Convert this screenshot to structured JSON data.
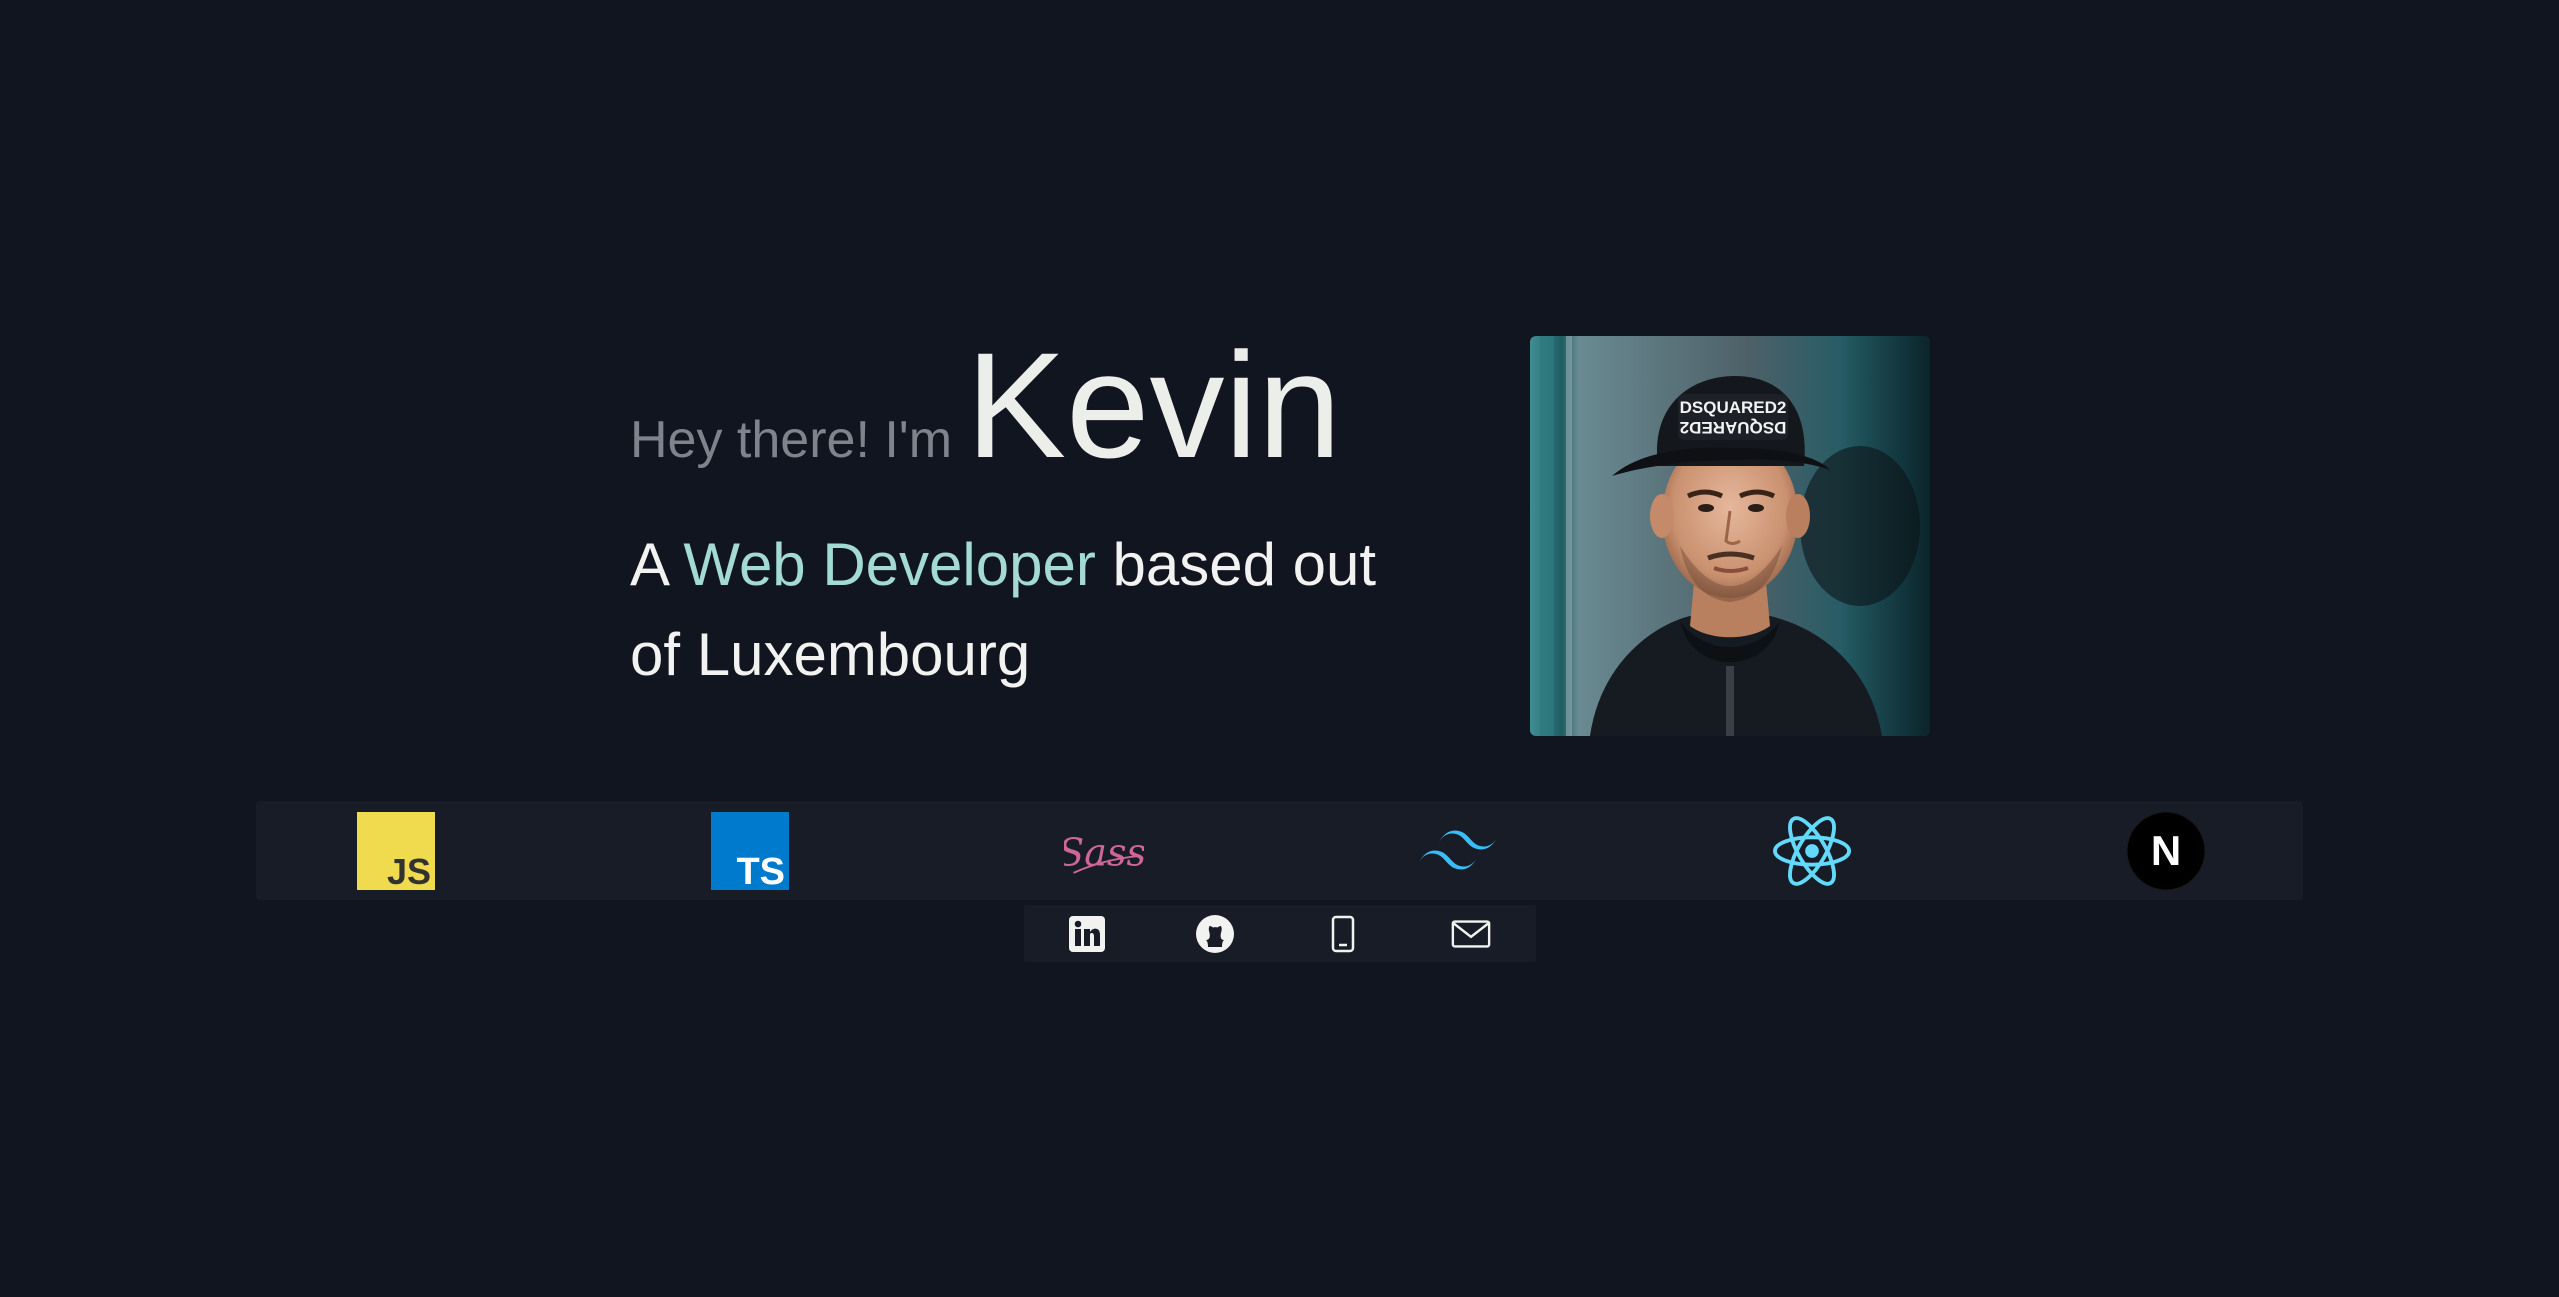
{
  "hero": {
    "greeting": "Hey there! I'm",
    "name": "Kevin",
    "tagline_prefix": "A ",
    "tagline_highlight": "Web Developer",
    "tagline_suffix": " based out of Luxembourg"
  },
  "portrait": {
    "alt": "Portrait photo of Kevin wearing a DSQUARED2 cap",
    "cap_text_top": "DSQUARED2",
    "cap_text_bottom": "DSQUARED2"
  },
  "tech_stack": [
    {
      "name": "javascript",
      "icon": "javascript-icon",
      "label": "JS",
      "color": "#f0db4f"
    },
    {
      "name": "typescript",
      "icon": "typescript-icon",
      "label": "TS",
      "color": "#007acc"
    },
    {
      "name": "sass",
      "icon": "sass-icon",
      "label": "Sass",
      "color": "#cd6799"
    },
    {
      "name": "tailwind",
      "icon": "tailwind-icon",
      "color": "#38bdf8"
    },
    {
      "name": "react",
      "icon": "react-icon",
      "color": "#61dafb"
    },
    {
      "name": "nextjs",
      "icon": "nextjs-icon",
      "label": "N",
      "color": "#000000"
    }
  ],
  "social": [
    {
      "name": "linkedin",
      "icon": "linkedin-icon"
    },
    {
      "name": "github",
      "icon": "github-icon"
    },
    {
      "name": "phone",
      "icon": "phone-icon"
    },
    {
      "name": "email",
      "icon": "mail-icon"
    }
  ],
  "colors": {
    "background": "#111520",
    "bar": "#171c27",
    "accent": "#a3dad6",
    "muted": "#80838b",
    "text": "#f2f3f0"
  }
}
